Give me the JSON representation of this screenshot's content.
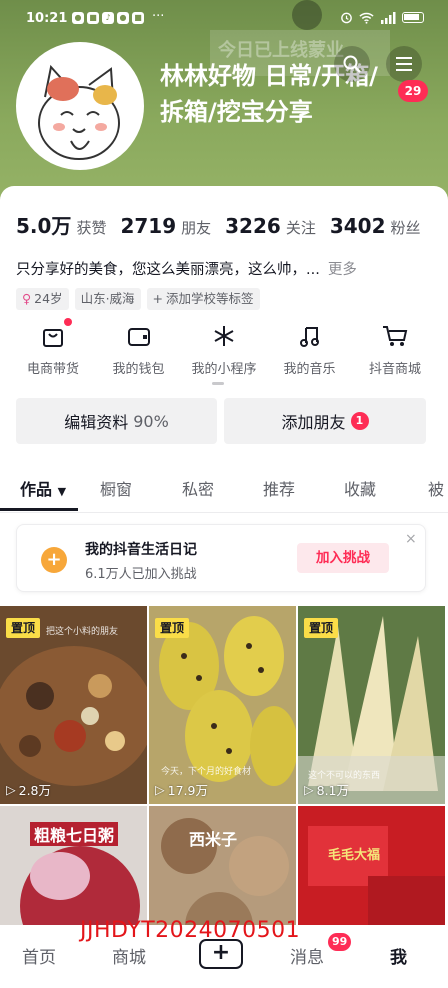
{
  "status_bar": {
    "time": "10:21",
    "more": "···"
  },
  "header": {
    "background_text": "今日已上线蒙业",
    "username": "林林好物 日常/开箱/拆箱/挖宝分享",
    "notification_count": "29"
  },
  "stats": [
    {
      "value": "5.0万",
      "label": "获赞"
    },
    {
      "value": "2719",
      "label": "朋友"
    },
    {
      "value": "3226",
      "label": "关注"
    },
    {
      "value": "3402",
      "label": "粉丝"
    }
  ],
  "bio": {
    "text": "只分享好的美食，您这么美丽漂亮，这么帅，...",
    "more": "更多"
  },
  "tags": [
    {
      "symbol": "♀",
      "label": "24岁"
    },
    {
      "symbol": "",
      "label": "山东·威海"
    },
    {
      "symbol": "+",
      "label": "添加学校等标签"
    }
  ],
  "shortcuts": [
    {
      "icon": "shop-bag-icon",
      "label": "电商带货"
    },
    {
      "icon": "wallet-icon",
      "label": "我的钱包"
    },
    {
      "icon": "mini-program-icon",
      "label": "我的小程序"
    },
    {
      "icon": "music-note-icon",
      "label": "我的音乐"
    },
    {
      "icon": "shopping-cart-icon",
      "label": "抖音商城"
    }
  ],
  "actions": {
    "edit_profile": "编辑资料",
    "edit_profile_pct": "90%",
    "add_friends": "添加朋友",
    "add_friends_badge": "1"
  },
  "tabs": [
    "作品",
    "橱窗",
    "私密",
    "推荐",
    "收藏",
    "被"
  ],
  "challenge": {
    "title": "我的抖音生活日记",
    "subtitle": "6.1万人已加入挑战",
    "join": "加入挑战",
    "close": "×"
  },
  "videos": [
    {
      "pinned": "置顶",
      "plays": "2.8万",
      "caption": "把这个小料的朋友"
    },
    {
      "pinned": "置顶",
      "plays": "17.9万",
      "caption": "今天，下个月的好食材"
    },
    {
      "pinned": "置顶",
      "plays": "8.1万",
      "caption": "这个不可以的东西"
    },
    {
      "pinned": "",
      "plays": "",
      "caption": "",
      "overlay": "粗粮七日粥"
    },
    {
      "pinned": "",
      "plays": "",
      "caption": "",
      "overlay": "西米子"
    },
    {
      "pinned": "",
      "plays": "",
      "caption": "",
      "overlay": "毛毛大福"
    }
  ],
  "watermark": "JJHDYT2024070501",
  "bottom_nav": {
    "home": "首页",
    "mall": "商城",
    "plus": "+",
    "messages": "消息",
    "messages_badge": "99",
    "me": "我"
  },
  "colors": {
    "accent": "#fe2c55",
    "pin": "#fadd48",
    "header_green": "#7f9c52"
  }
}
